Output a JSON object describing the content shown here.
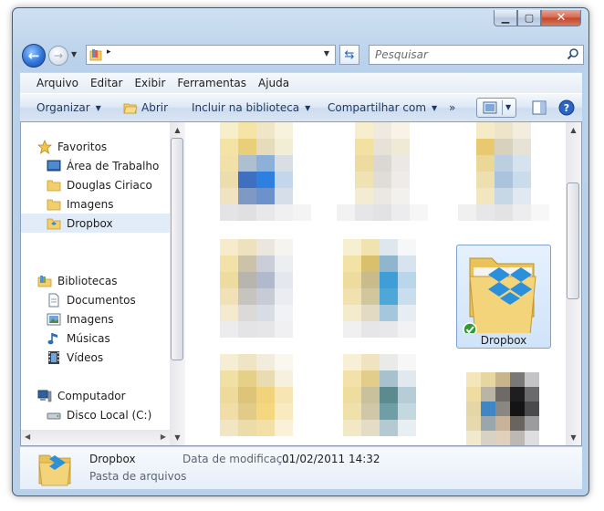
{
  "window": {
    "caption_buttons": [
      "minimize",
      "maximize",
      "close"
    ]
  },
  "address": {
    "separator": "▸",
    "search_placeholder": "Pesquisar"
  },
  "menu": {
    "items": [
      "Arquivo",
      "Editar",
      "Exibir",
      "Ferramentas",
      "Ajuda"
    ]
  },
  "commands": {
    "organize": "Organizar",
    "open": "Abrir",
    "include": "Incluir na biblioteca",
    "share": "Compartilhar com",
    "more": "»"
  },
  "nav": {
    "favorites": "Favoritos",
    "favorites_items": [
      "Área de Trabalho",
      "Douglas Ciriaco",
      "Imagens",
      "Dropbox"
    ],
    "libraries": "Bibliotecas",
    "library_items": [
      "Documentos",
      "Imagens",
      "Músicas",
      "Vídeos"
    ],
    "computer": "Computador",
    "computer_items": [
      "Disco Local (C:)"
    ]
  },
  "files": {
    "selected_label": "Dropbox"
  },
  "details": {
    "name": "Dropbox",
    "type": "Pasta de arquivos",
    "date_label": "Data de modificaç...",
    "date_value": "01/02/2011 14:32"
  },
  "colors": {
    "accent": "#2a6fd6",
    "selection": "#cfe3fa",
    "folder": "#f2cf6b",
    "dropbox_blue": "#2b8fd9",
    "check_green": "#2f9b33"
  }
}
